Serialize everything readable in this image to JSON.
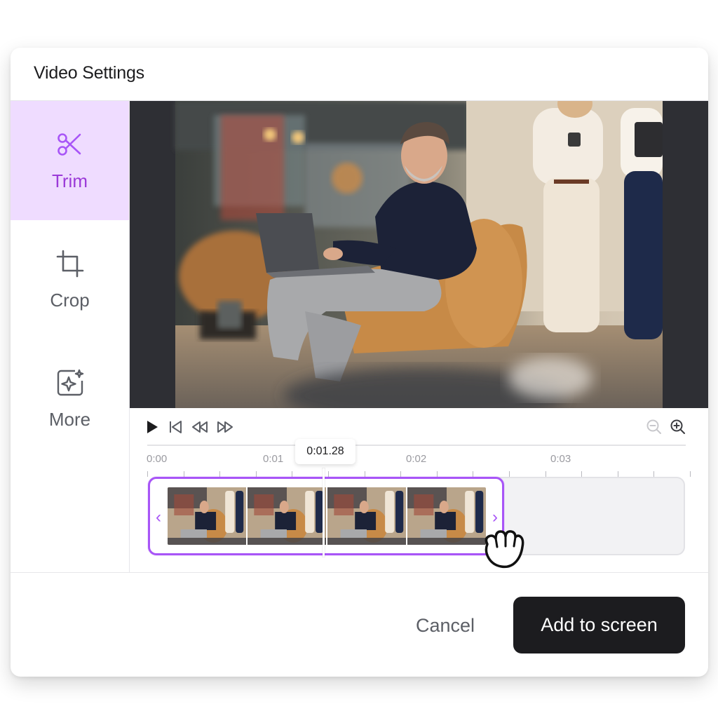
{
  "dialog": {
    "title": "Video Settings"
  },
  "sidebar": {
    "items": [
      {
        "label": "Trim",
        "icon": "scissors-icon",
        "active": true
      },
      {
        "label": "Crop",
        "icon": "crop-icon",
        "active": false
      },
      {
        "label": "More",
        "icon": "sparkle-icon",
        "active": false
      }
    ]
  },
  "preview": {
    "description_icon": "video-frame"
  },
  "playback": {
    "controls": [
      "play-icon",
      "skip-to-start-icon",
      "rewind-icon",
      "fast-forward-icon"
    ],
    "zoom": [
      "zoom-out-icon",
      "zoom-in-icon"
    ]
  },
  "timeline": {
    "ruler_labels": [
      "0:00",
      "0:01",
      "0:02",
      "0:03"
    ],
    "current_time": "0:01.28",
    "handle_left": "‹",
    "handle_right": "›"
  },
  "footer": {
    "cancel_label": "Cancel",
    "confirm_label": "Add to screen"
  },
  "colors": {
    "accent": "#a855f7",
    "accent_text": "#9b3ad8",
    "active_bg": "#efdcff",
    "primary_button": "#1c1c1f"
  }
}
